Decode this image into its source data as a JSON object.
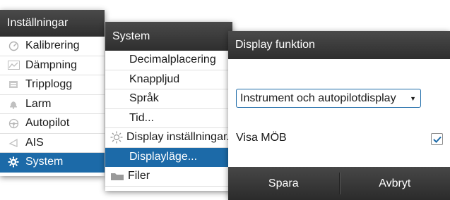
{
  "panel_settings": {
    "title": "Inställningar",
    "items": [
      {
        "label": "Kalibrering",
        "icon": "gauge-icon"
      },
      {
        "label": "Dämpning",
        "icon": "damping-icon"
      },
      {
        "label": "Tripplogg",
        "icon": "triplog-icon"
      },
      {
        "label": "Larm",
        "icon": "bell-icon"
      },
      {
        "label": "Autopilot",
        "icon": "helm-icon"
      },
      {
        "label": "AIS",
        "icon": "ais-icon"
      },
      {
        "label": "System",
        "icon": "gear-icon",
        "selected": true
      }
    ]
  },
  "panel_system": {
    "title": "System",
    "items": [
      {
        "label": "Decimalplacering"
      },
      {
        "label": "Knappljud"
      },
      {
        "label": "Språk"
      },
      {
        "label": "Tid..."
      },
      {
        "label": "Display inställningar...",
        "icon": "sun-icon"
      },
      {
        "label": "Displayläge...",
        "selected": true
      },
      {
        "label": "Filer",
        "icon": "folder-icon"
      }
    ]
  },
  "dialog": {
    "title": "Display funktion",
    "dropdown_value": "Instrument och autopilotdisplay",
    "mob_label": "Visa MÖB",
    "mob_checked": true,
    "save_label": "Spara",
    "cancel_label": "Avbryt"
  },
  "colors": {
    "selection": "#1c6aa8",
    "titlebar": "#3a3a3a"
  }
}
